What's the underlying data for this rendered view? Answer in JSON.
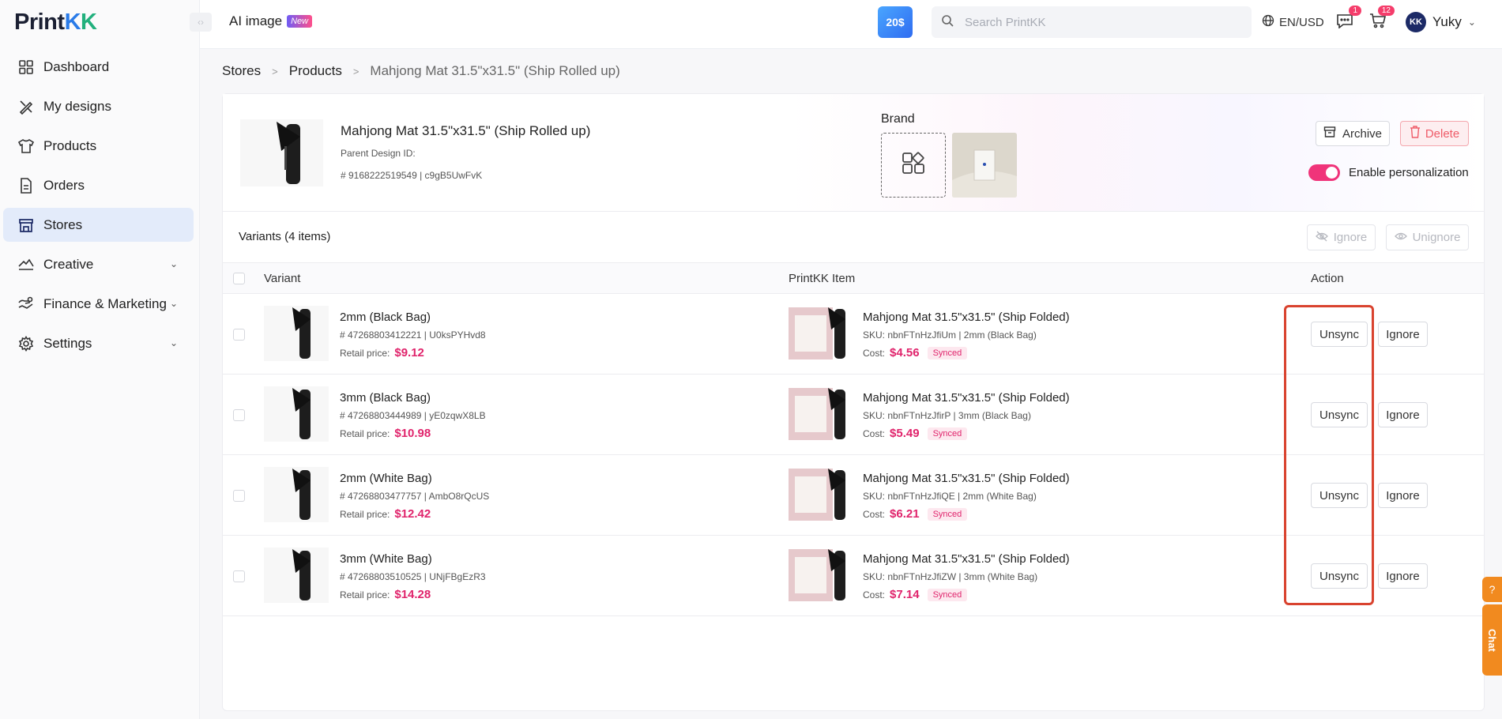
{
  "app": {
    "logo_text_main": "Print",
    "logo_k1": "K",
    "logo_k2": "K"
  },
  "sidebar": {
    "items": [
      {
        "label": "Dashboard",
        "icon": "dashboard-icon",
        "active": false
      },
      {
        "label": "My designs",
        "icon": "designs-icon",
        "active": false
      },
      {
        "label": "Products",
        "icon": "tshirt-icon",
        "active": false
      },
      {
        "label": "Orders",
        "icon": "document-icon",
        "active": false
      },
      {
        "label": "Stores",
        "icon": "store-icon",
        "active": true
      },
      {
        "label": "Creative",
        "icon": "creative-icon",
        "active": false,
        "expandable": true
      },
      {
        "label": "Finance & Marketing",
        "icon": "finance-icon",
        "active": false,
        "expandable": true
      },
      {
        "label": "Settings",
        "icon": "gear-icon",
        "active": false,
        "expandable": true
      }
    ]
  },
  "header": {
    "ai_image_label": "AI image",
    "new_badge": "New",
    "promo_text": "20$",
    "search_placeholder": "Search PrintKK",
    "lang_currency": "EN/USD",
    "messages_count": "1",
    "cart_count": "12",
    "user_initials": "KK",
    "user_name": "Yuky"
  },
  "breadcrumb": {
    "items": [
      "Stores",
      "Products"
    ],
    "current": "Mahjong Mat 31.5\"x31.5\" (Ship Rolled up)"
  },
  "product": {
    "title": "Mahjong Mat 31.5\"x31.5\" (Ship Rolled up)",
    "parent_label": "Parent Design ID:",
    "ids": "# 9168222519549 | c9gB5UwFvK",
    "brand_label": "Brand",
    "archive_label": "Archive",
    "delete_label": "Delete",
    "personalization_label": "Enable personalization",
    "personalization_enabled": true
  },
  "variants": {
    "title": "Variants (4 items)",
    "ignore_label": "Ignore",
    "unignore_label": "Unignore",
    "columns": {
      "variant": "Variant",
      "item": "PrintKK Item",
      "action": "Action"
    },
    "rows": [
      {
        "name": "2mm (Black Bag)",
        "ids": "# 47268803412221 | U0ksPYHvd8",
        "retail_label": "Retail price:",
        "retail_price": "$9.12",
        "item_name": "Mahjong Mat 31.5\"x31.5\" (Ship Folded)",
        "sku": "SKU: nbnFTnHzJfiUm  | 2mm (Black Bag)",
        "cost_label": "Cost:",
        "cost": "$4.56",
        "status": "Synced",
        "unsync_label": "Unsync",
        "ignore_label": "Ignore"
      },
      {
        "name": "3mm (Black Bag)",
        "ids": "# 47268803444989 | yE0zqwX8LB",
        "retail_label": "Retail price:",
        "retail_price": "$10.98",
        "item_name": "Mahjong Mat 31.5\"x31.5\" (Ship Folded)",
        "sku": "SKU: nbnFTnHzJfirP  | 3mm (Black Bag)",
        "cost_label": "Cost:",
        "cost": "$5.49",
        "status": "Synced",
        "unsync_label": "Unsync",
        "ignore_label": "Ignore"
      },
      {
        "name": "2mm (White Bag)",
        "ids": "# 47268803477757 | AmbO8rQcUS",
        "retail_label": "Retail price:",
        "retail_price": "$12.42",
        "item_name": "Mahjong Mat 31.5\"x31.5\" (Ship Folded)",
        "sku": "SKU: nbnFTnHzJfiQE  | 2mm (White Bag)",
        "cost_label": "Cost:",
        "cost": "$6.21",
        "status": "Synced",
        "unsync_label": "Unsync",
        "ignore_label": "Ignore"
      },
      {
        "name": "3mm (White Bag)",
        "ids": "# 47268803510525 | UNjFBgEzR3",
        "retail_label": "Retail price:",
        "retail_price": "$14.28",
        "item_name": "Mahjong Mat 31.5\"x31.5\" (Ship Folded)",
        "sku": "SKU: nbnFTnHzJfiZW  | 3mm (White Bag)",
        "cost_label": "Cost:",
        "cost": "$7.14",
        "status": "Synced",
        "unsync_label": "Unsync",
        "ignore_label": "Ignore"
      }
    ]
  },
  "floating": {
    "help_icon": "help-icon",
    "chat_label": "Chat"
  },
  "colors": {
    "accent": "#e0246c",
    "active_nav": "#e3ebfa",
    "highlight": "#d9432f",
    "float": "#f18a1f"
  }
}
